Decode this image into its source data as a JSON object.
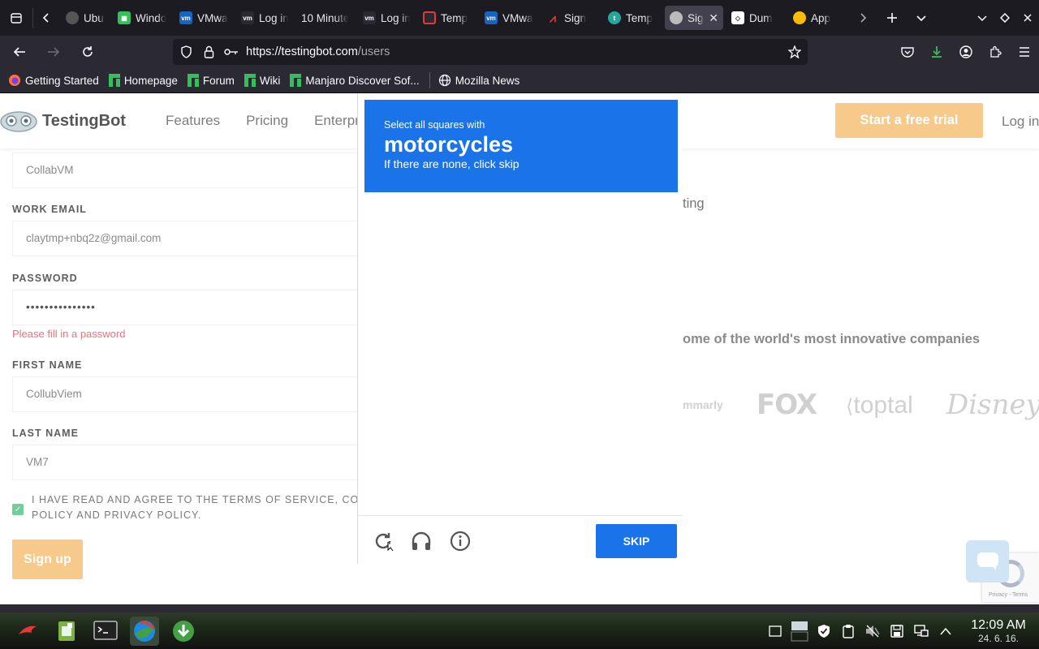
{
  "browser": {
    "tabs": [
      {
        "label": "Ubuntu",
        "icon": "ubuntu-icon",
        "color": "#e95420"
      },
      {
        "label": "Windows",
        "icon": "grid-icon",
        "color": "#35bf5c"
      },
      {
        "label": "VMware",
        "icon": "vmware-icon",
        "color": "#1565c0"
      },
      {
        "label": "Log in",
        "icon": "vm-icon",
        "color": "#555"
      },
      {
        "label": "10 Minute",
        "icon": "",
        "color": ""
      },
      {
        "label": "Log in",
        "icon": "vm-icon",
        "color": "#555"
      },
      {
        "label": "Temp",
        "icon": "temp-icon",
        "color": "#c0392b"
      },
      {
        "label": "VMware",
        "icon": "vmware-icon",
        "color": "#1565c0"
      },
      {
        "label": "Sign",
        "icon": "pulse-icon",
        "color": "#e53935"
      },
      {
        "label": "Temp",
        "icon": "tm-icon",
        "color": "#26a69a"
      },
      {
        "label": "Sign",
        "icon": "testingbot-icon",
        "color": "#999",
        "active": true
      },
      {
        "label": "Dum",
        "icon": "dumb-icon",
        "color": "#fff"
      },
      {
        "label": "App",
        "icon": "chrome-icon",
        "color": "#fbbc05"
      }
    ],
    "url_host": "https://testingbot.com",
    "url_path": "/users",
    "bookmarks": [
      {
        "label": "Getting Started",
        "icon": "firefox-icon"
      },
      {
        "label": "Homepage",
        "icon": "manjaro-icon"
      },
      {
        "label": "Forum",
        "icon": "manjaro-icon"
      },
      {
        "label": "Wiki",
        "icon": "manjaro-icon"
      },
      {
        "label": "Manjaro Discover Sof...",
        "icon": "manjaro-icon"
      },
      {
        "label": "Mozilla News",
        "icon": "globe-icon"
      }
    ]
  },
  "site": {
    "logo": "TestingBot",
    "menu": [
      "Features",
      "Pricing",
      "Enterpr"
    ],
    "trial_button": "Start a free trial",
    "login": "Log in",
    "form": {
      "company_value": "CollabVM",
      "email_label": "WORK EMAIL",
      "email_value": "claytmp+nbq2z@gmail.com",
      "password_label": "PASSWORD",
      "password_value": "•••••••••••••••",
      "password_error": "Please fill in a password",
      "first_name_label": "FIRST NAME",
      "first_name_value": "CollubViem",
      "last_name_label": "LAST NAME",
      "last_name_value": "VM7",
      "terms_line1": "I HAVE READ AND AGREE TO THE TERMS OF SERVICE, COOKI",
      "terms_line2": "POLICY AND PRIVACY POLICY.",
      "signup_button": "Sign up"
    },
    "right_text_1": "ting",
    "right_text_2": "ome of the world's most innovative companies",
    "brands": [
      "mmarly",
      "FOX",
      "toptal",
      "Disney"
    ],
    "recaptcha_text": "Privacy - Terms"
  },
  "captcha": {
    "prompt": "Select all squares with",
    "target": "motorcycles",
    "subtitle": "If there are none, click skip",
    "skip_button": "SKIP"
  },
  "taskbar": {
    "time": "12:09 AM",
    "date": "24. 6. 16."
  }
}
